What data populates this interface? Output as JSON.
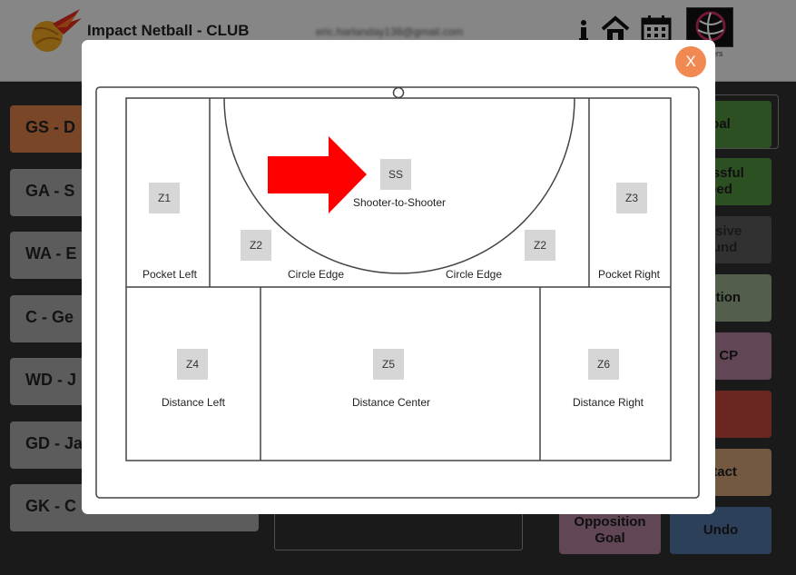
{
  "header": {
    "title": "Impact Netball - CLUB",
    "email": "eric.harlanday138@gmail.com",
    "club_sub": "ers"
  },
  "players": [
    {
      "label": "GS - D",
      "active": true
    },
    {
      "label": "GA - S",
      "active": false
    },
    {
      "label": "WA - E",
      "active": false
    },
    {
      "label": "C - Ge",
      "active": false
    },
    {
      "label": "WD - J",
      "active": false
    },
    {
      "label": "GD - Ja",
      "active": false
    },
    {
      "label": "GK - C",
      "active": false
    }
  ],
  "actions": {
    "goal": "oal",
    "unsuccessful_feed": "cessful\need",
    "defensive_rebound": "ensive\nound",
    "interception": "ection",
    "opp_cp": "o. CP",
    "contact": "ntact",
    "opposition_goal": "Opposition\nGoal",
    "undo": "Undo"
  },
  "modal": {
    "close_label": "X",
    "zones": {
      "ss": {
        "code": "SS",
        "name": "Shooter-to-Shooter"
      },
      "z1": {
        "code": "Z1",
        "name": "Pocket Left"
      },
      "z2_left": {
        "code": "Z2",
        "name": "Circle Edge"
      },
      "z2_right": {
        "code": "Z2",
        "name": "Circle Edge"
      },
      "z3": {
        "code": "Z3",
        "name": "Pocket Right"
      },
      "z4": {
        "code": "Z4",
        "name": "Distance Left"
      },
      "z5": {
        "code": "Z5",
        "name": "Distance Center"
      },
      "z6": {
        "code": "Z6",
        "name": "Distance Right"
      }
    }
  },
  "colors": {
    "active_player": "#d07a45",
    "player": "#9f9f9f",
    "goal": "#4f8a3c",
    "feed": "#4f8a3c",
    "rebound": "#555555",
    "interception": "#8fa383",
    "opp_cp": "#a77b94",
    "red": "#b8423c",
    "contact": "#c69a72",
    "opp_goal": "#a77b94",
    "undo": "#4d6f9b",
    "arrow": "#ff0000",
    "close": "#f08a52"
  }
}
